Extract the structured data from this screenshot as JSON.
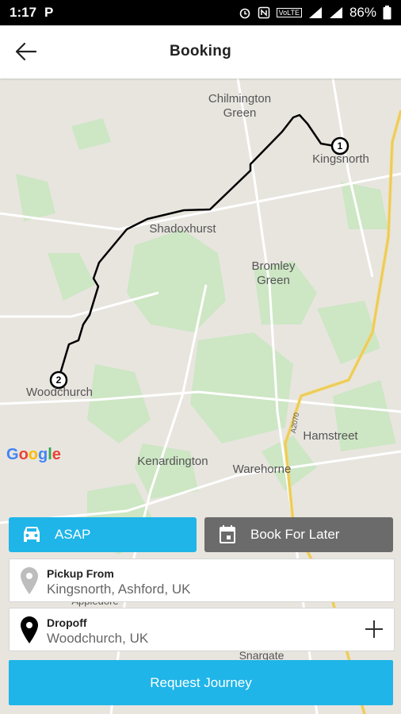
{
  "status_bar": {
    "time": "1:17",
    "carrier_icon": "P",
    "volte": "VoLTE",
    "battery": "86%"
  },
  "header": {
    "title": "Booking",
    "back_icon": "arrow-left-icon"
  },
  "map": {
    "labels": {
      "chilmington": "Chilmington\nGreen",
      "kingsnorth": "Kingsnorth",
      "shadoxhurst": "Shadoxhurst",
      "bromley": "Bromley\nGreen",
      "woodchurch": "Woodchurch",
      "hamstreet": "Hamstreet",
      "kenardington": "Kenardington",
      "warehorne": "Warehorne",
      "appledore": "Appledore",
      "snargate": "Snargate",
      "road_a2070": "A2070"
    },
    "markers": {
      "start": "1",
      "end": "2"
    },
    "logo": {
      "g1": "G",
      "o1": "o",
      "o2": "o",
      "g2": "g",
      "l": "l",
      "e": "e"
    },
    "route_color": "#000000",
    "road_color": "#f2d56b"
  },
  "booking": {
    "asap_label": "ASAP",
    "later_label": "Book For Later",
    "pickup_label": "Pickup From",
    "pickup_value": "Kingsnorth, Ashford, UK",
    "dropoff_label": "Dropoff",
    "dropoff_value": "Woodchurch, UK",
    "request_label": "Request Journey"
  },
  "colors": {
    "accent": "#1fb5e8",
    "secondary": "#6b6b6b"
  }
}
